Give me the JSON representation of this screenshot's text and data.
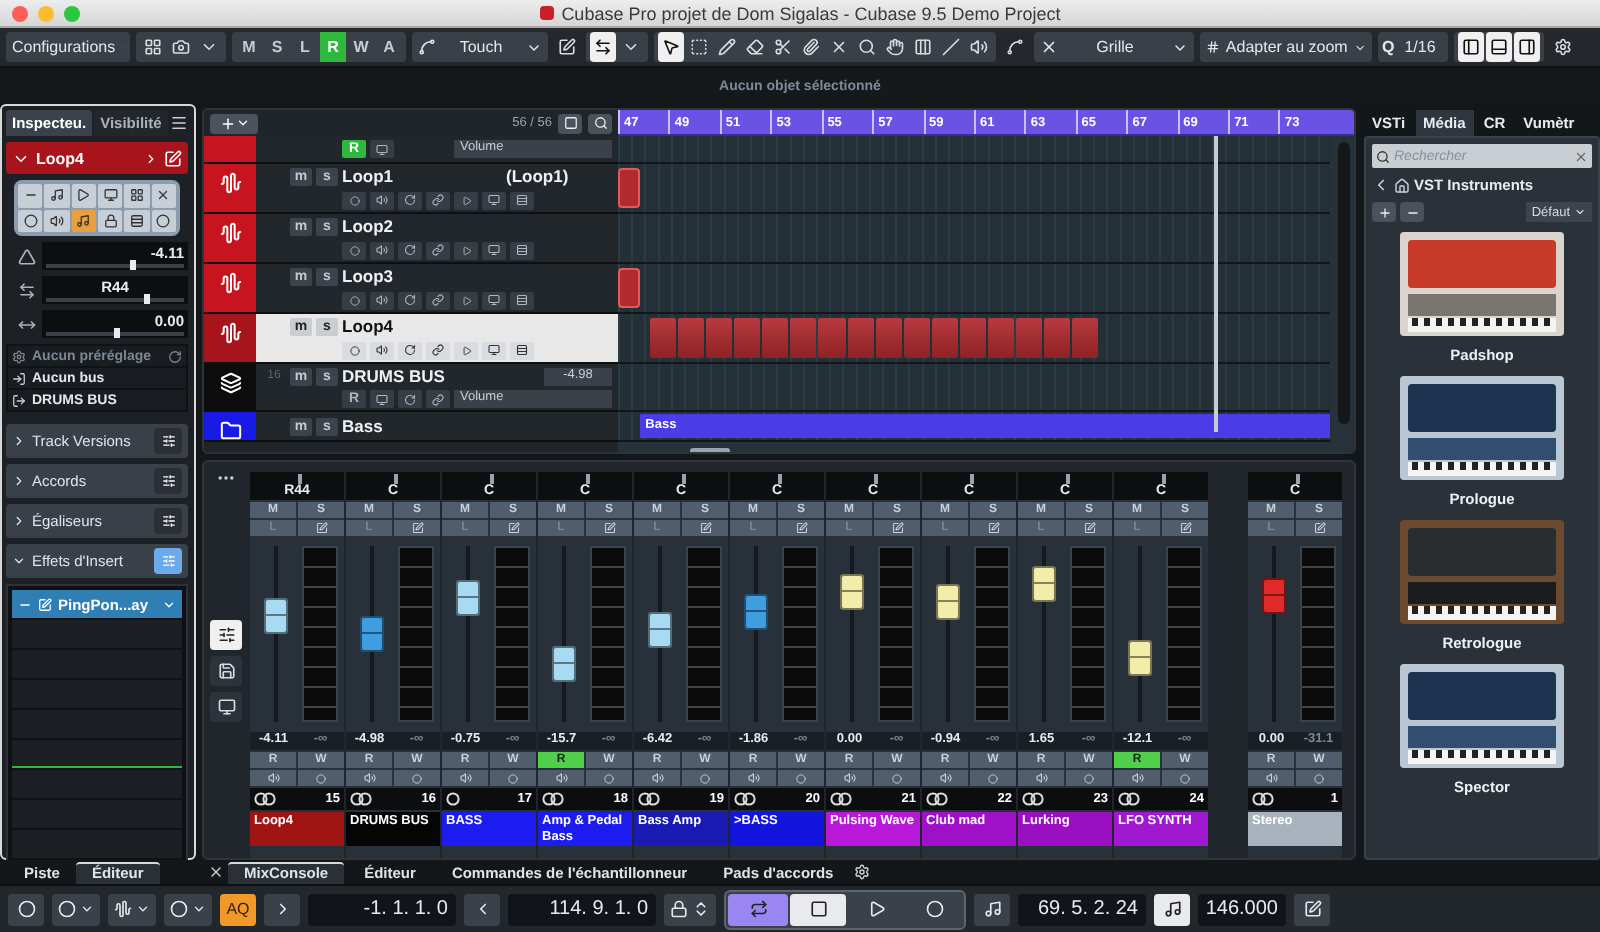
{
  "window": {
    "title": "Cubase Pro projet de Dom Sigalas - Cubase 9.5 Demo Project"
  },
  "toolbar": {
    "configurations": "Configurations",
    "modes": [
      {
        "label": "M",
        "selected": false
      },
      {
        "label": "S",
        "selected": false
      },
      {
        "label": "L",
        "selected": false
      },
      {
        "label": "R",
        "selected": true
      },
      {
        "label": "W",
        "selected": false
      },
      {
        "label": "A",
        "selected": false
      }
    ],
    "automation_mode": "Touch",
    "tools": [
      {
        "kind": "pointer",
        "selected": true
      },
      {
        "kind": "range",
        "selected": false
      },
      {
        "kind": "pencil",
        "selected": false
      },
      {
        "kind": "eraser",
        "selected": false
      },
      {
        "kind": "scissors",
        "selected": false
      },
      {
        "kind": "glue",
        "selected": false
      },
      {
        "kind": "mute",
        "selected": false
      },
      {
        "kind": "zoom",
        "selected": false
      },
      {
        "kind": "hand",
        "selected": false
      },
      {
        "kind": "bars",
        "selected": false
      },
      {
        "kind": "line",
        "selected": false
      },
      {
        "kind": "speaker",
        "selected": false
      }
    ],
    "snap_type": "Grille",
    "snap_mode": "Adapter au zoom",
    "quantize_label": "Q",
    "quantize": "1/16"
  },
  "info_line": "Aucun objet sélectionné",
  "inspector": {
    "tabs": [
      {
        "label": "Inspecteu.",
        "selected": true
      },
      {
        "label": "Visibilité",
        "selected": false
      }
    ],
    "track_name": "Loop4",
    "params": [
      {
        "kind": "volume",
        "value": "-4.11",
        "level": 0.62
      },
      {
        "kind": "pan",
        "value": "R44",
        "level": 0.72
      },
      {
        "kind": "delay",
        "value": "0.00",
        "level": 0.5
      }
    ],
    "preset": "Aucun préréglage",
    "input": "Aucun bus",
    "output": "DRUMS BUS",
    "sections": [
      {
        "label": "Track Versions",
        "expanded": false
      },
      {
        "label": "Accords",
        "expanded": false
      },
      {
        "label": "Égaliseurs",
        "expanded": false
      },
      {
        "label": "Effets d'Insert",
        "expanded": true
      }
    ],
    "inserts": [
      {
        "name": "PingPon...ay"
      }
    ]
  },
  "project": {
    "track_count": "56 / 56",
    "ruler": [
      "47",
      "49",
      "51",
      "53",
      "55",
      "57",
      "59",
      "61",
      "63",
      "65",
      "67",
      "69",
      "71",
      "73"
    ],
    "tracks": [
      {
        "kind": "partial",
        "color": "#c8141e",
        "selected": false,
        "read": "R",
        "read_on": true,
        "param": "Volume"
      },
      {
        "kind": "audio",
        "name": "Loop1",
        "comment": "(Loop1)",
        "color": "#c8141e",
        "selected": false,
        "mute": "m",
        "solo": "s",
        "clip": {
          "kind": "stub"
        }
      },
      {
        "kind": "audio",
        "name": "Loop2",
        "color": "#c8141e",
        "selected": false,
        "mute": "m",
        "solo": "s"
      },
      {
        "kind": "audio",
        "name": "Loop3",
        "color": "#c8141e",
        "selected": false,
        "mute": "m",
        "solo": "s",
        "clip": {
          "kind": "stub"
        }
      },
      {
        "kind": "audio",
        "name": "Loop4",
        "color": "#a8141c",
        "selected": true,
        "mute": "m",
        "solo": "s",
        "clip": {
          "kind": "pattern"
        }
      },
      {
        "kind": "group",
        "name": "DRUMS BUS",
        "number": "16",
        "value": "-4.98",
        "color": "#0c0c0c",
        "selected": false,
        "mute": "m",
        "solo": "s",
        "read": "R",
        "read_on": false,
        "param": "Volume"
      },
      {
        "kind": "folder",
        "name": "Bass",
        "color": "#1a1ae6",
        "selected": false,
        "mute": "m",
        "solo": "s",
        "clip": {
          "kind": "bar",
          "label": "Bass"
        }
      }
    ]
  },
  "mixer": {
    "channels": [
      {
        "pan": "R44",
        "mute": "M",
        "solo": "S",
        "listen": "L",
        "fader": {
          "level": 0.6,
          "color": "#a8daf6"
        },
        "volume": "-4.11",
        "peak": "-∞",
        "read": "R",
        "write": "W",
        "read_on": false,
        "stereo": true,
        "number": "15",
        "name": "Loop4",
        "color": "#a01414"
      },
      {
        "pan": "C",
        "mute": "M",
        "solo": "S",
        "listen": "L",
        "fader": {
          "level": 0.5,
          "color": "#3e9ee0"
        },
        "volume": "-4.98",
        "peak": "-∞",
        "read": "R",
        "write": "W",
        "read_on": false,
        "stereo": true,
        "number": "16",
        "name": "DRUMS BUS",
        "color": "#050505"
      },
      {
        "pan": "C",
        "mute": "M",
        "solo": "S",
        "listen": "L",
        "fader": {
          "level": 0.7,
          "color": "#a8daf6"
        },
        "volume": "-0.75",
        "peak": "-∞",
        "read": "R",
        "write": "W",
        "read_on": false,
        "stereo": false,
        "number": "17",
        "name": "BASS",
        "color": "#1c1cf0"
      },
      {
        "pan": "C",
        "mute": "M",
        "solo": "S",
        "listen": "L",
        "fader": {
          "level": 0.33,
          "color": "#a8daf6"
        },
        "volume": "-15.7",
        "peak": "-∞",
        "read": "R",
        "write": "W",
        "read_on": true,
        "stereo": true,
        "number": "18",
        "name": "Amp & Pedal Bass",
        "color": "#1c1cf0"
      },
      {
        "pan": "C",
        "mute": "M",
        "solo": "S",
        "listen": "L",
        "fader": {
          "level": 0.52,
          "color": "#a8daf6"
        },
        "volume": "-6.42",
        "peak": "-∞",
        "read": "R",
        "write": "W",
        "read_on": false,
        "stereo": true,
        "number": "19",
        "name": "Bass Amp",
        "color": "#1a1ab4"
      },
      {
        "pan": "C",
        "mute": "M",
        "solo": "S",
        "listen": "L",
        "fader": {
          "level": 0.63,
          "color": "#3e9ee0"
        },
        "volume": "-1.86",
        "peak": "-∞",
        "read": "R",
        "write": "W",
        "read_on": false,
        "stereo": true,
        "number": "20",
        "name": ">BASS",
        "color": "#1414e0"
      },
      {
        "pan": "C",
        "mute": "M",
        "solo": "S",
        "listen": "L",
        "fader": {
          "level": 0.74,
          "color": "#f2eeaa"
        },
        "volume": "0.00",
        "peak": "-∞",
        "read": "R",
        "write": "W",
        "read_on": false,
        "stereo": true,
        "number": "21",
        "name": "Pulsing Wave",
        "color": "#b818d8"
      },
      {
        "pan": "C",
        "mute": "M",
        "solo": "S",
        "listen": "L",
        "fader": {
          "level": 0.68,
          "color": "#f2eeaa"
        },
        "volume": "-0.94",
        "peak": "-∞",
        "read": "R",
        "write": "W",
        "read_on": false,
        "stereo": true,
        "number": "22",
        "name": "Club mad",
        "color": "#a010c8"
      },
      {
        "pan": "C",
        "mute": "M",
        "solo": "S",
        "listen": "L",
        "fader": {
          "level": 0.78,
          "color": "#f2eeaa"
        },
        "volume": "1.65",
        "peak": "-∞",
        "read": "R",
        "write": "W",
        "read_on": false,
        "stereo": true,
        "number": "23",
        "name": "Lurking",
        "color": "#9a10c0"
      },
      {
        "pan": "C",
        "mute": "M",
        "solo": "S",
        "listen": "L",
        "fader": {
          "level": 0.36,
          "color": "#f2eeaa"
        },
        "volume": "-12.1",
        "peak": "-∞",
        "read": "R",
        "write": "W",
        "read_on": true,
        "stereo": true,
        "number": "24",
        "name": "LFO SYNTH",
        "color": "#a018d0"
      }
    ],
    "outputs": [
      {
        "pan": "C",
        "mute": "M",
        "solo": "S",
        "listen": "L",
        "fader": {
          "level": 0.72,
          "color": "#e02a2a"
        },
        "volume": "0.00",
        "peak": "-31.1",
        "read": "R",
        "write": "W",
        "read_on": false,
        "stereo": true,
        "number": "1",
        "name": "Stereo",
        "color": "#a9b3bd"
      }
    ]
  },
  "media_panel": {
    "tabs": [
      {
        "label": "VSTi",
        "selected": false
      },
      {
        "label": "Média",
        "selected": true
      },
      {
        "label": "CR",
        "selected": false
      },
      {
        "label": "Vumètr",
        "selected": false
      }
    ],
    "search_placeholder": "Rechercher",
    "breadcrumb": "VST Instruments",
    "sort": "Défaut",
    "items": [
      {
        "name": "Padshop",
        "kind": "light"
      },
      {
        "name": "Prologue",
        "kind": "blue"
      },
      {
        "name": "Retrologue",
        "kind": "dark"
      },
      {
        "name": "Spector",
        "kind": "blue"
      }
    ]
  },
  "left_zone_tabs": [
    {
      "label": "Piste",
      "selected": false
    },
    {
      "label": "Éditeur",
      "selected": true
    }
  ],
  "lower_zone_tabs": [
    {
      "label": "MixConsole",
      "selected": true
    },
    {
      "label": "Éditeur",
      "selected": false
    },
    {
      "label": "Commandes de l'échantillonneur",
      "selected": false
    },
    {
      "label": "Pads d'accords",
      "selected": false
    }
  ],
  "transport": {
    "auto_quantize": "AQ",
    "left_locator": "-1. 1. 1. 0",
    "right_locator": "114. 9. 1. 0",
    "cycle_on": true,
    "position": "69. 5. 2. 24",
    "tempo": "146.000"
  }
}
